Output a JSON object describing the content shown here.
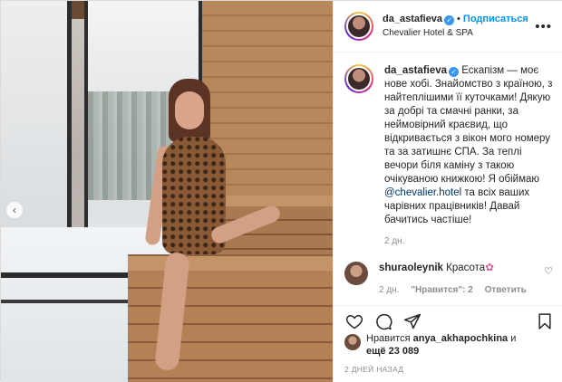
{
  "post": {
    "username": "da_astafieva",
    "verified_badge": "✓",
    "dot": "•",
    "follow_label": "Подписаться",
    "location": "Chevalier Hotel & SPA",
    "more_icon": "more-horizontal-icon",
    "more_glyph": "•••"
  },
  "caption": {
    "username": "da_astafieva",
    "text_before_mention": "Ескапізм — моє нове хобі. Знайомство з країною, з найтеплішими її куточками! Дякую за добрі та смачні ранки, за неймовірний краєвид, що відкривається з вікон мого номеру та за затишнє СПА. За теплі вечори біля каміну з такою очікуваною книжкою! Я обіймаю ",
    "mention": "@chevalier.hotel",
    "text_after_mention": " та всіх ваших чарівних працівників! Давай бачитись частіше!",
    "time": "2 дн."
  },
  "comment": {
    "username": "shuraoleynik",
    "text": "Красота",
    "emoji": "✿",
    "time": "2 дн.",
    "likes": "\"Нравится\": 2",
    "reply": "Ответить"
  },
  "likes": {
    "prefix": "Нравится ",
    "username": "anya_akhapochkina",
    "and": " и",
    "more": "ещё 23 089"
  },
  "posted_ago": "2 ДНЕЙ НАЗАД",
  "nav": {
    "prev_glyph": "‹"
  },
  "colors": {
    "accent": "#0095f6",
    "mention": "#00376b",
    "muted": "#8e8e8e"
  }
}
